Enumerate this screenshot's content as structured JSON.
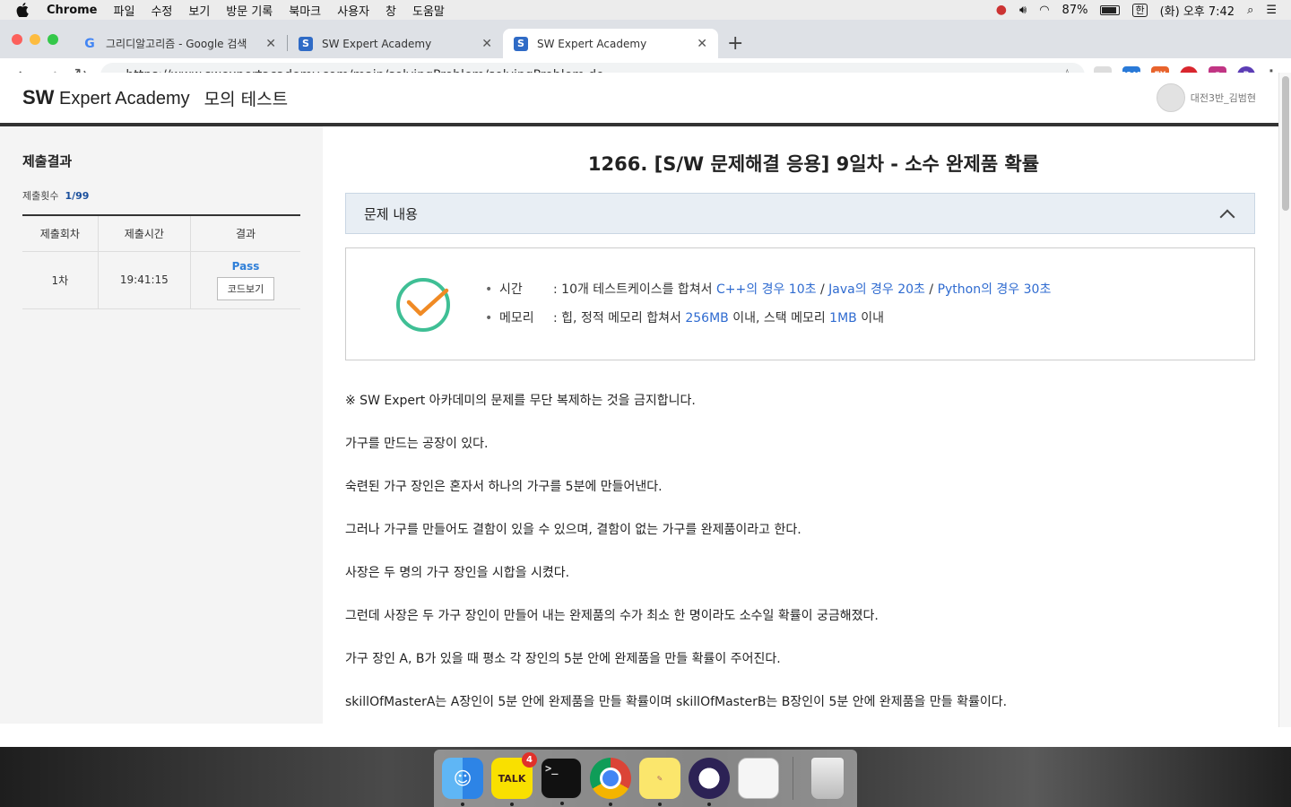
{
  "menubar": {
    "app": "Chrome",
    "items": [
      "파일",
      "수정",
      "보기",
      "방문 기록",
      "북마크",
      "사용자",
      "창",
      "도움말"
    ],
    "battery": "87%",
    "input_lang": "한",
    "clock": "(화) 오후 7:42"
  },
  "tabs": [
    {
      "title": "그리디알고리즘 - Google 검색",
      "icon": "google-icon"
    },
    {
      "title": "SW Expert Academy",
      "icon": "swea-icon"
    },
    {
      "title": "SW Expert Academy",
      "icon": "swea-icon",
      "active": true
    }
  ],
  "toolbar": {
    "url": "https://www.swexpertacademy.com/main/solvingProblem/solvingProblem.do",
    "ext_badge": "2249",
    "profile_initial": "B"
  },
  "site": {
    "logo_sw": "SW",
    "logo_rest": " Expert Academy",
    "mode": "모의 테스트",
    "user": "대전3반_김범현"
  },
  "sidebar": {
    "title": "제출결과",
    "count_label": "제출횟수",
    "count_value": "1/99",
    "headers": [
      "제출회차",
      "제출시간",
      "결과"
    ],
    "row": {
      "round": "1차",
      "time": "19:41:15",
      "result": "Pass",
      "code_btn": "코드보기"
    }
  },
  "problem": {
    "title": "1266. [S/W 문제해결 응용] 9일차 - 소수 완제품 확률",
    "section": "문제 내용",
    "limits": {
      "time_label": "시간",
      "time_prefix": ": 10개 테스트케이스를 합쳐서 ",
      "time_cpp": "C++의 경우 10초",
      "sep1": " / ",
      "time_java": "Java의 경우 20초",
      "sep2": " / ",
      "time_py": "Python의 경우 30초",
      "mem_label": "메모리",
      "mem_prefix": ": 힙, 정적 메모리 합쳐서 ",
      "mem_heap": "256MB",
      "mem_mid": " 이내, 스택 메모리 ",
      "mem_stack": "1MB",
      "mem_suffix": " 이내"
    },
    "paragraphs": [
      "※ SW Expert 아카데미의 문제를 무단 복제하는 것을 금지합니다.",
      "가구를 만드는 공장이 있다.",
      "숙련된 가구 장인은 혼자서 하나의 가구를 5분에 만들어낸다.",
      "그러나 가구를 만들어도 결함이 있을 수 있으며, 결함이 없는 가구를 완제품이라고 한다.",
      "사장은 두 명의 가구 장인을 시합을 시켰다.",
      "그런데 사장은 두 가구 장인이 만들어 내는 완제품의 수가 최소 한 명이라도 소수일 확률이 궁금해졌다.",
      "가구 장인 A, B가 있을 때 평소 각 장인의 5분 안에 완제품을 만들 확률이 주어진다.",
      "skillOfMasterA는 A장인이 5분 안에 완제품을 만들 확률이며 skillOfMasterB는 B장인이 5분 안에 완제품을 만들 확률이다."
    ]
  },
  "dock": {
    "talk_label": "TALK",
    "talk_badge": "4",
    "terminal_prompt": ">_"
  },
  "colors": {
    "link": "#2f6bd0",
    "pass": "#2f7fd8",
    "check_circle": "#3fbf95",
    "check_mark": "#f08a24"
  }
}
